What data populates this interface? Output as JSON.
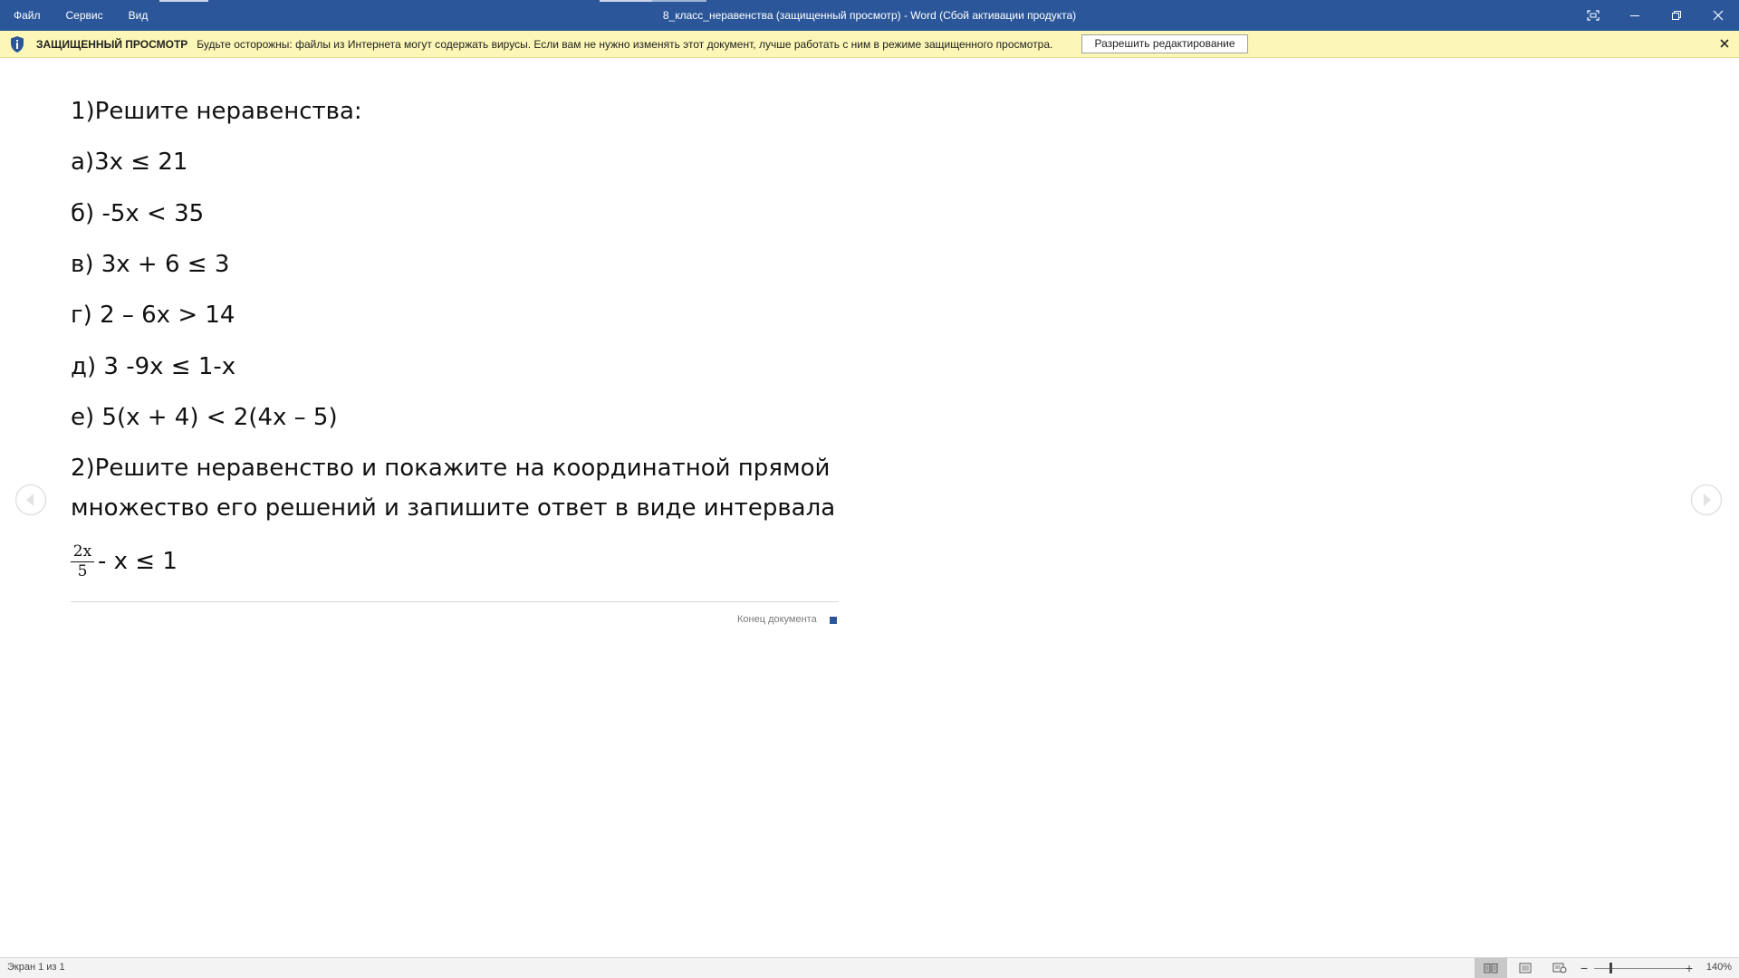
{
  "window": {
    "title": "8_класс_неравенства (защищенный просмотр) - Word (Сбой активации продукта)",
    "menu": [
      "Файл",
      "Сервис",
      "Вид"
    ]
  },
  "message_bar": {
    "title": "ЗАЩИЩЕННЫЙ ПРОСМОТР",
    "text": "Будьте осторожны: файлы из Интернета могут содержать вирусы. Если вам не нужно изменять этот документ, лучше работать с ним в режиме защищенного просмотра.",
    "button": "Разрешить редактирование"
  },
  "document": {
    "lines": [
      "1)Решите неравенства:",
      "а)3х ≤ 21",
      "б) -5х < 35",
      "в) 3х + 6 ≤ 3",
      "г) 2 – 6х > 14",
      "д) 3 -9х ≤ 1-х",
      "е) 5(х + 4) < 2(4х – 5)",
      "2)Решите неравенство и покажите на координатной прямой",
      "множество его решений и запишите ответ в виде интервала"
    ],
    "fraction": {
      "numerator": "2x",
      "denominator": "5",
      "rest": "- х ≤ 1"
    },
    "end_label": "Конец документа"
  },
  "status_bar": {
    "page": "Экран 1 из 1",
    "zoom": "140%",
    "views": [
      "read-mode",
      "print-layout",
      "web-layout"
    ],
    "active_view": "read-mode"
  },
  "colors": {
    "accent": "#2b579a",
    "message_bar": "#fcf7b6"
  }
}
